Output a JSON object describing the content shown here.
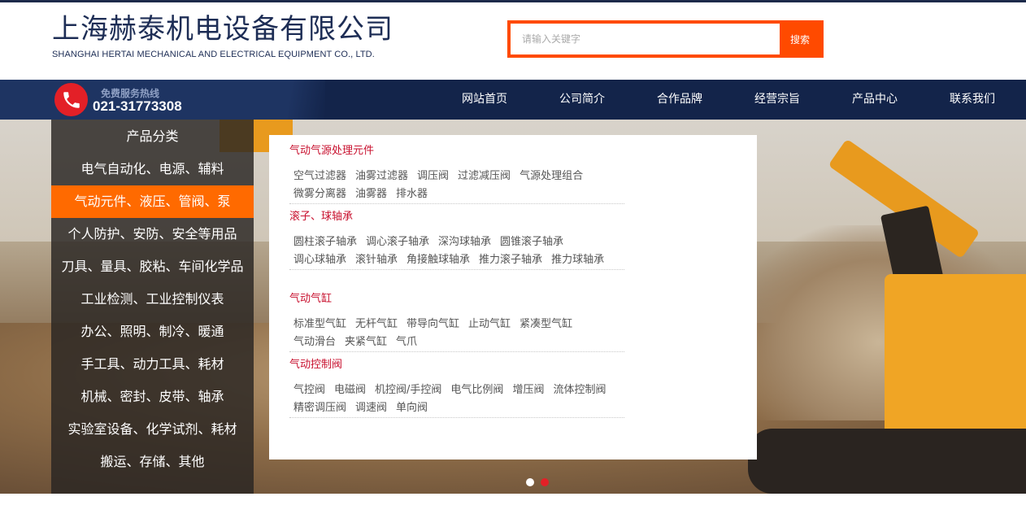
{
  "header": {
    "logo_cn": "上海赫泰机电设备有限公司",
    "logo_en": "SHANGHAI HERTAI MECHANICAL AND ELECTRICAL EQUIPMENT CO., LTD.",
    "search_placeholder": "请输入关键字",
    "search_button": "搜索"
  },
  "hotline": {
    "label": "免费服务热线",
    "number": "021-31773308"
  },
  "nav": {
    "items": [
      "网站首页",
      "公司简介",
      "合作品牌",
      "经营宗旨",
      "产品中心",
      "联系我们"
    ]
  },
  "categories": {
    "title": "产品分类",
    "items": [
      "电气自动化、电源、辅料",
      "气动元件、液压、管阀、泵",
      "个人防护、安防、安全等用品",
      "刀具、量具、胶粘、车间化学品",
      "工业检测、工业控制仪表",
      "办公、照明、制冷、暖通",
      "手工具、动力工具、耗材",
      "机械、密封、皮带、轴承",
      "实验室设备、化学试剂、耗材",
      "搬运、存储、其他"
    ],
    "active_index": 1
  },
  "dropdown": {
    "groups": [
      {
        "title": "气动气源处理元件",
        "links": [
          "空气过滤器",
          "油雾过滤器",
          "调压阀",
          "过滤减压阀",
          "气源处理组合",
          "微雾分离器",
          "油雾器",
          "排水器"
        ]
      },
      {
        "title": "滚子、球轴承",
        "links": [
          "圆柱滚子轴承",
          "调心滚子轴承",
          "深沟球轴承",
          "圆锥滚子轴承",
          "调心球轴承",
          "滚针轴承",
          "角接触球轴承",
          "推力滚子轴承",
          "推力球轴承"
        ]
      },
      {
        "title": "气动气缸",
        "links": [
          "标准型气缸",
          "无杆气缸",
          "带导向气缸",
          "止动气缸",
          "紧凑型气缸",
          "气动滑台",
          "夹紧气缸",
          "气爪"
        ]
      },
      {
        "title": "气动控制阀",
        "links": [
          "气控阀",
          "电磁阀",
          "机控阀/手控阀",
          "电气比例阀",
          "增压阀",
          "流体控制阀",
          "精密调压阀",
          "调速阀",
          "单向阀"
        ]
      }
    ]
  },
  "slider": {
    "dot_count": 2,
    "active_dot": 1
  },
  "colors": {
    "brand_navy": "#13244a",
    "accent_orange": "#ff6a00",
    "search_orange": "#ff4a00",
    "link_red": "#c8102e"
  }
}
